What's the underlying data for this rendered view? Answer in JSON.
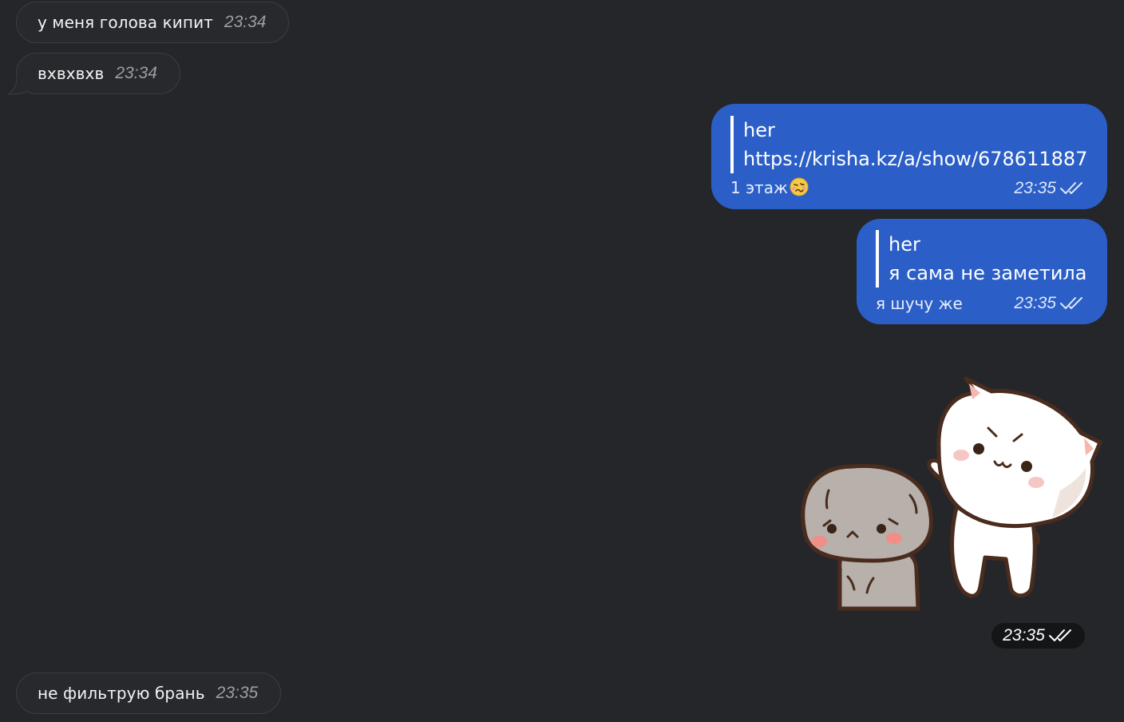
{
  "messages_in": [
    {
      "text": "у меня голова кипит",
      "time": "23:34"
    },
    {
      "text": "вхвхвхв",
      "time": "23:34"
    },
    {
      "text": "не фильтрую брань",
      "time": "23:35"
    }
  ],
  "messages_out": [
    {
      "quote_name": "her",
      "quote_text": "https://krisha.kz/a/show/678611887",
      "text": "1 этаж",
      "emoji": "woozy-face-icon",
      "time": "23:35",
      "status": "read"
    },
    {
      "quote_name": "her",
      "quote_text": "я сама не заметила",
      "text": "я шучу же",
      "time": "23:35",
      "status": "read"
    }
  ],
  "sticker": {
    "description": "two cats sticker",
    "time": "23:35",
    "status": "read"
  },
  "colors": {
    "background": "#242629",
    "incoming_bubble": "#27292c",
    "outgoing_bubble": "#2b5fc7",
    "time_incoming": "#9aa0a7"
  }
}
